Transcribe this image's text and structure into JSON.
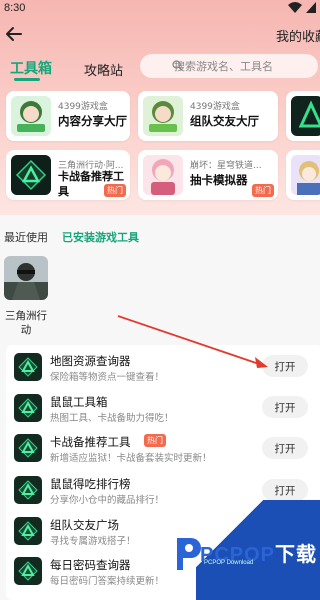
{
  "status_bar": {
    "time": "8:30"
  },
  "header": {
    "favorites": "我的收藏"
  },
  "tabs": {
    "toolbox": "工具箱",
    "strategy": "攻略站"
  },
  "search": {
    "placeholder": "搜索游戏名、工具名"
  },
  "cards": [
    {
      "subtitle": "4399游戏盒",
      "title": "内容分享大厅"
    },
    {
      "subtitle": "4399游戏盒",
      "title": "组队交友大厅"
    },
    {
      "subtitle": "三角洲行动·阿...",
      "title": "卡战备推荐工具",
      "tag": "热门"
    },
    {
      "subtitle": "崩坏：星穹铁道...",
      "title": "抽卡模拟器",
      "tag": "热门"
    }
  ],
  "sections": {
    "recent": "最近使用",
    "installed": "已安装游戏工具"
  },
  "recent_items": [
    {
      "name": "三角洲行动"
    }
  ],
  "tools": [
    {
      "name": "地图资源查询器",
      "desc": "保险箱等物资点一键查看！",
      "button": "打开"
    },
    {
      "name": "鼠鼠工具箱",
      "desc": "热图工具、卡战备助力得吃！",
      "button": "打开"
    },
    {
      "name": "卡战备推荐工具",
      "tag": "热门",
      "desc": "新增适应监狱！卡战备套装实时更新！",
      "button": "打开"
    },
    {
      "name": "鼠鼠得吃排行榜",
      "desc": "分享你小仓中的藏品排行！",
      "button": "打开"
    },
    {
      "name": "组队交友广场",
      "desc": "寻找专属游戏搭子！"
    },
    {
      "name": "每日密码查询器",
      "desc": "每日密码门答案持续更新！"
    }
  ],
  "watermark": {
    "brand_a": "PCPOP",
    "brand_b": "下载",
    "sub": "PCPOP Download"
  },
  "colors": {
    "accent": "#17a679",
    "hot": "#f26b4f",
    "header_bg": "#f6b6b1"
  }
}
